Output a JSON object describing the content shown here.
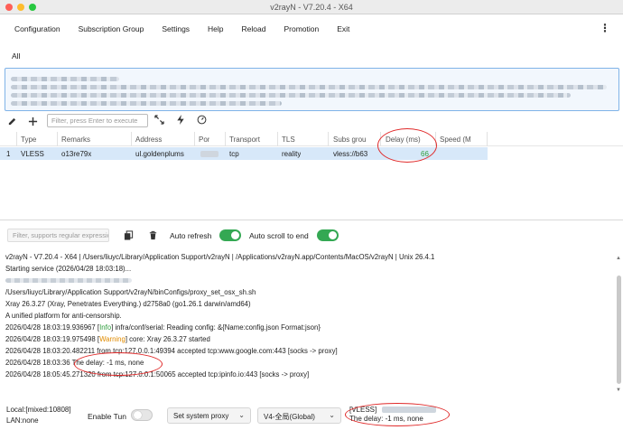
{
  "window": {
    "title": "v2rayN - V7.20.4 - X64"
  },
  "menu": {
    "items": [
      {
        "label": "Configuration"
      },
      {
        "label": "Subscription Group"
      },
      {
        "label": "Settings"
      },
      {
        "label": "Help"
      },
      {
        "label": "Reload"
      },
      {
        "label": "Promotion"
      },
      {
        "label": "Exit"
      }
    ]
  },
  "group_tab": {
    "label": "All"
  },
  "toolbar": {
    "filter_placeholder": "Filter, press Enter to execute"
  },
  "table": {
    "headers": [
      "Type",
      "Remarks",
      "Address",
      "Por",
      "Transport",
      "TLS",
      "Subs grou",
      "Delay (ms)",
      "Speed (M"
    ],
    "row": {
      "index": "1",
      "type": "VLESS",
      "remarks": "o13re79x",
      "address": "ul.goldenplums",
      "transport": "tcp",
      "tls": "reality",
      "subs": "vless://b63",
      "delay": "66"
    }
  },
  "log_toolbar": {
    "filter_placeholder": "Filter, supports regular expression",
    "auto_refresh_label": "Auto refresh",
    "auto_refresh_on": true,
    "auto_scroll_label": "Auto scroll to end",
    "auto_scroll_on": true
  },
  "log": {
    "line1": "v2rayN - V7.20.4 - X64 | /Users/liuyc/Library/Application Support/v2rayN | /Applications/v2rayN.app/Contents/MacOS/v2rayN | Unix 26.4.1",
    "line2": "Starting service (2026/04/28 18:03:18)...",
    "line4": "/Users/liuyc/Library/Application Support/v2rayN/binConfigs/proxy_set_osx_sh.sh",
    "line5": "Xray 26.3.27 (Xray, Penetrates Everything.) d2758a0 (go1.26.1 darwin/amd64)",
    "line6": "A unified platform for anti-censorship.",
    "line7_pre": "2026/04/28 18:03:19.936967 [",
    "line7_tag": "Info",
    "line7_post": "] infra/conf/serial: Reading config: &{Name:config.json Format:json}",
    "line8_pre": "2026/04/28 18:03:19.975498 [",
    "line8_tag": "Warning",
    "line8_post": "] core: Xray 26.3.27 started",
    "line9": "2026/04/28 18:03:20.482211 from tcp:127.0.0.1:49394 accepted tcp:www.google.com:443 [socks -> proxy]",
    "line10": "2026/04/28 18:03:36 The delay: -1 ms, none",
    "line11": "2026/04/28 18:05:45.271320 from tcp:127.0.0.1:50065 accepted tcp:ipinfo.io:443 [socks -> proxy]"
  },
  "status": {
    "local": "Local:[mixed:10808]",
    "lan": "LAN:none",
    "enable_tun_label": "Enable Tun",
    "enable_tun_on": false,
    "system_proxy": "Set system proxy",
    "routing": "V4-全局(Global)",
    "server_type": "[VLESS]",
    "server_delay": "The delay: -1 ms, none"
  },
  "icons": [
    "edit-icon",
    "add-icon",
    "expand-icon",
    "bolt-icon",
    "speedometer-icon",
    "copy-icon",
    "trash-icon",
    "more-vertical-icon"
  ],
  "colors": {
    "accent": "#3b82f6",
    "toggle_on": "#34a853",
    "selected_row": "#d7e8f9",
    "annotation": "#e02a2a",
    "info": "#2e9d3c",
    "warning": "#e08b00"
  }
}
